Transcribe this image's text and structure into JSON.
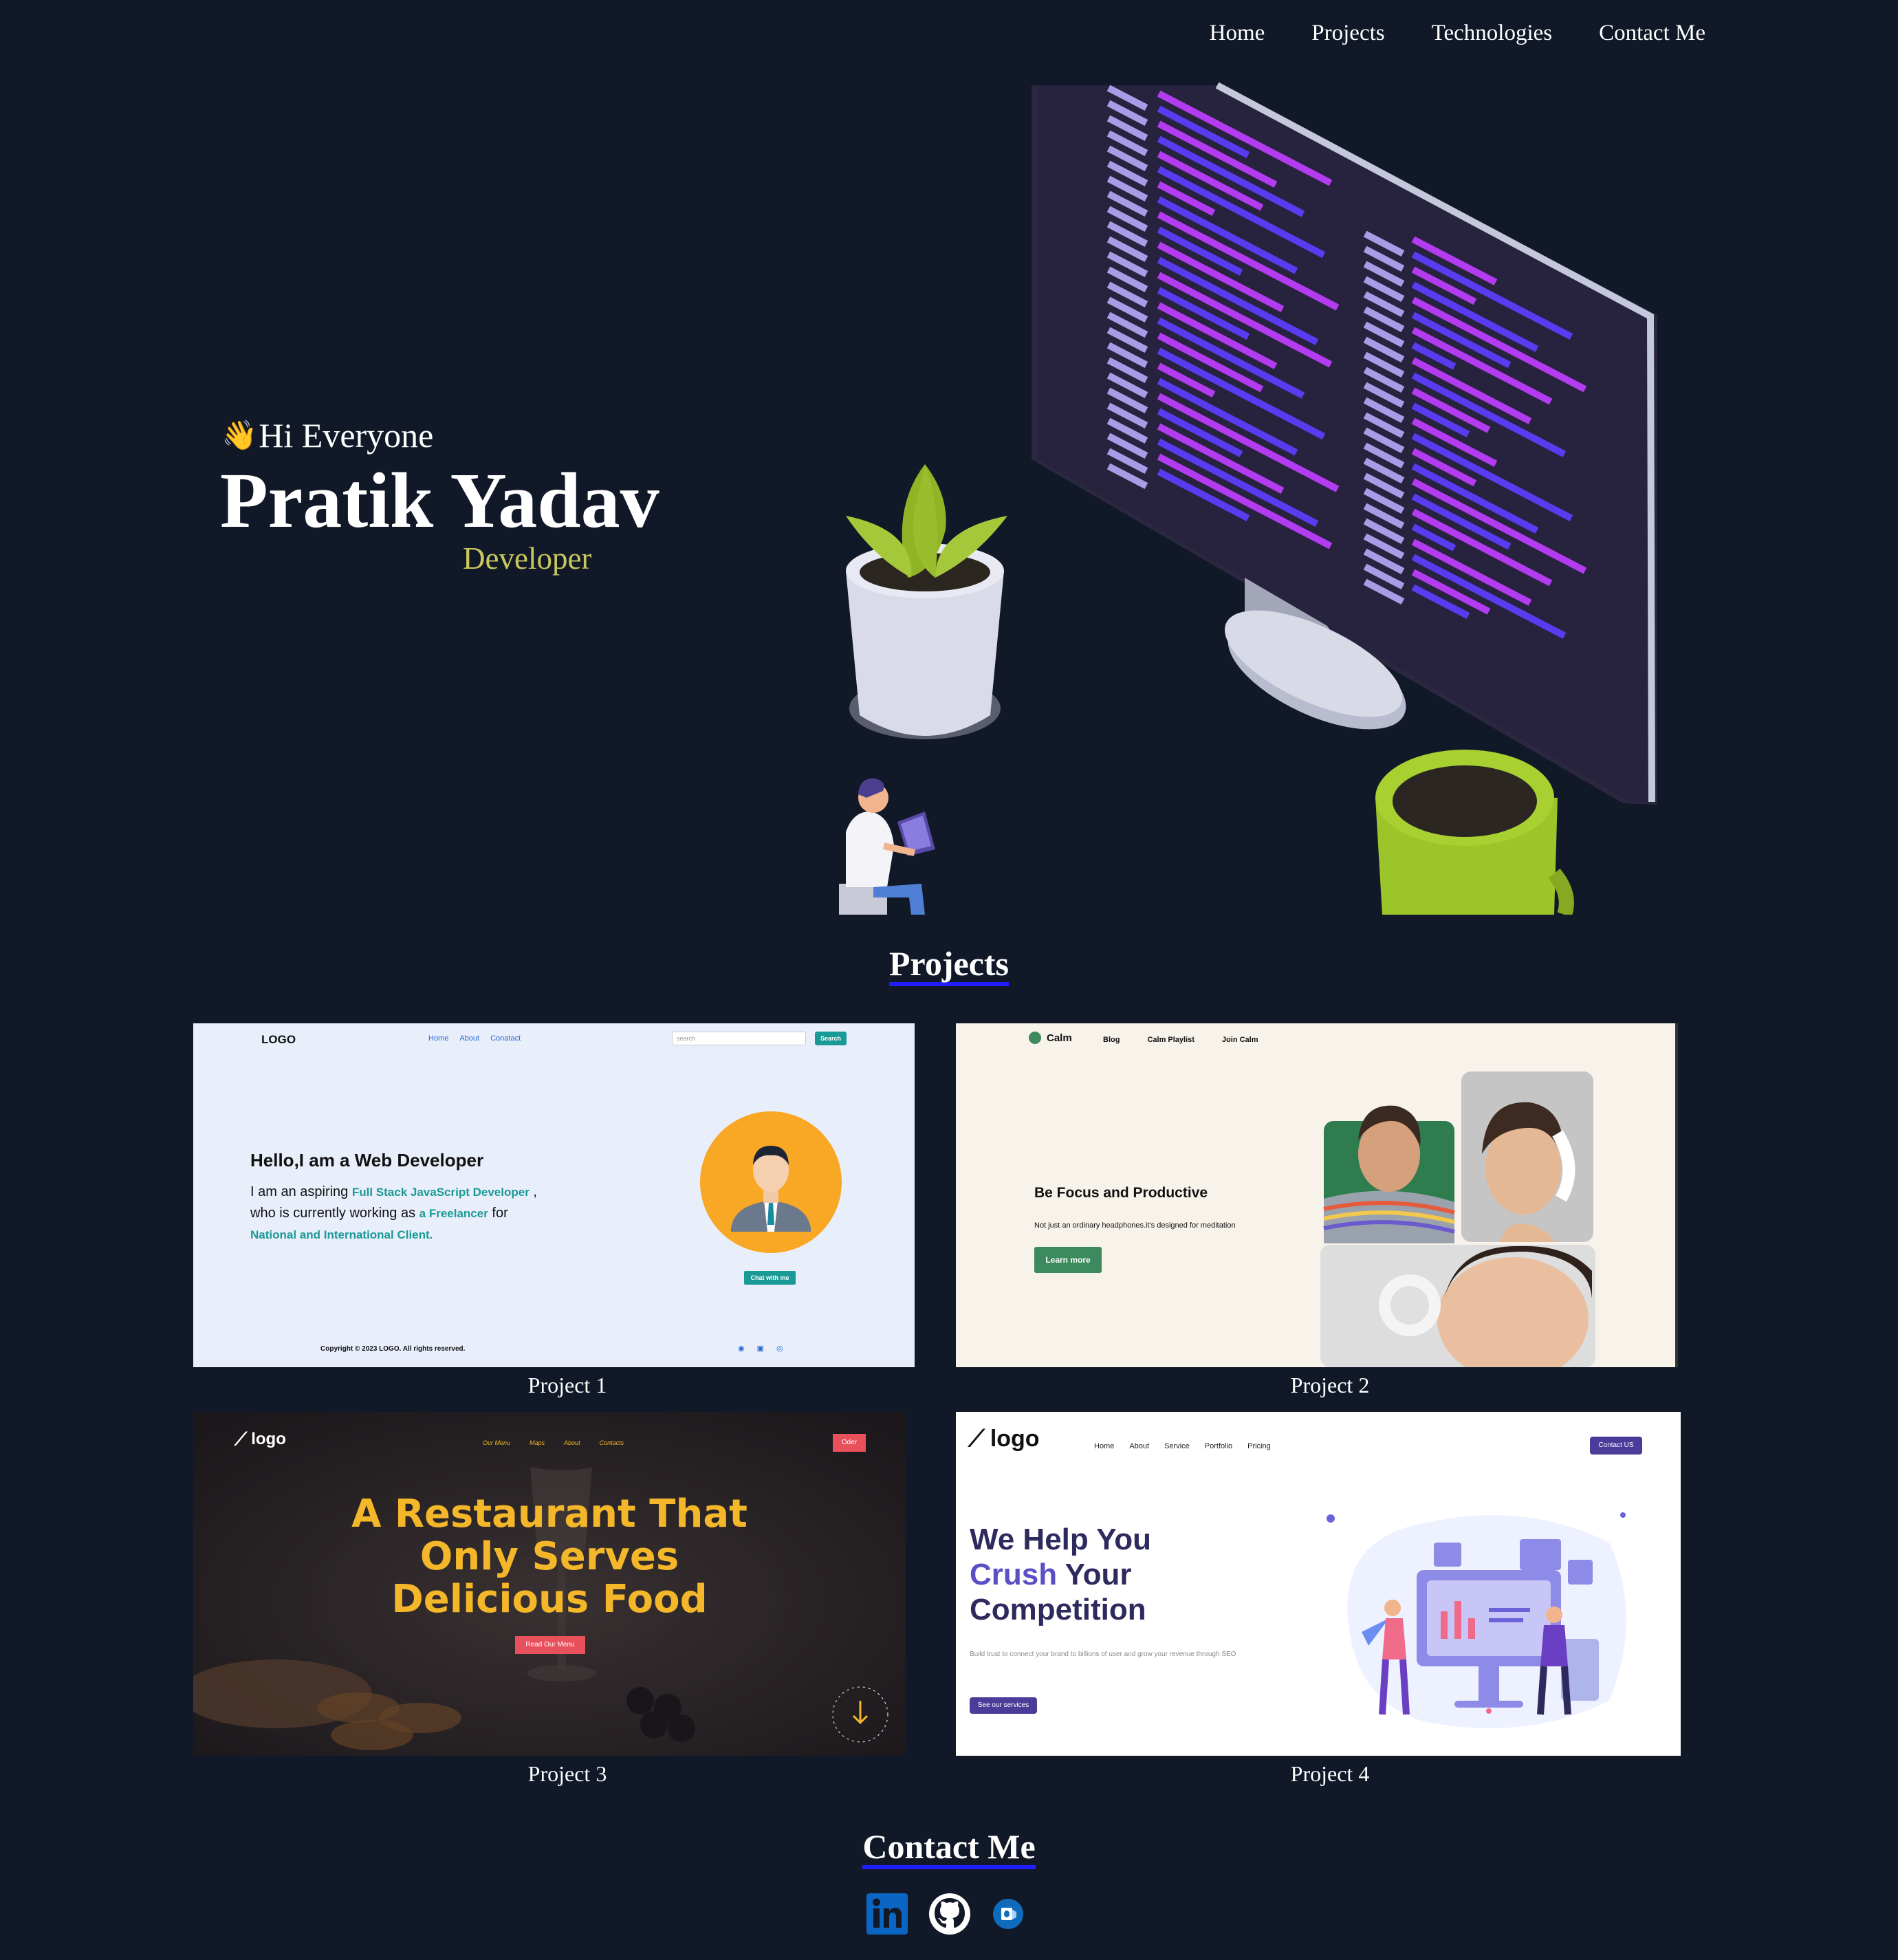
{
  "nav": {
    "items": [
      "Home",
      "Projects",
      "Technologies",
      "Contact Me"
    ]
  },
  "hero": {
    "greeting_emoji": "👋",
    "greeting": "Hi Everyone",
    "name": "Pratik Yadav",
    "role": "Developer"
  },
  "projects": {
    "title": "Projects",
    "items": [
      {
        "caption": "Project 1",
        "logo": "LOGO",
        "nav": [
          "Home",
          "About",
          "Conatact"
        ],
        "search_placeholder": "search",
        "search_button": "Search",
        "heading": "Hello,I am a Web Developer",
        "body_1": "I am an aspiring",
        "body_hl_1": "Full Stack JavaScript Developer",
        "body_2": ",",
        "body_3": "who is currently working as",
        "body_hl_2": "a Freelancer",
        "body_4": "for",
        "body_hl_3": "National and International Client.",
        "cta": "Chat with me",
        "footer": "Copyright © 2023 LOGO. All rights reserved."
      },
      {
        "caption": "Project 2",
        "logo": "Calm",
        "nav": [
          "Blog",
          "Calm Playlist",
          "Join Calm"
        ],
        "heading": "Be Focus and Productive",
        "sub": "Not just an ordinary headphones.it's designed for meditation",
        "cta": "Learn more"
      },
      {
        "caption": "Project 3",
        "logo": "logo",
        "nav": [
          "Our Menu",
          "Maps",
          "About",
          "Contacts"
        ],
        "order": "Oder",
        "headline_1": "A Restaurant That",
        "headline_2": "Only Serves",
        "headline_3": "Delicious Food",
        "cta": "Read Our Menu",
        "scroll_text": "scroll • scroll •"
      },
      {
        "caption": "Project 4",
        "logo": "logo",
        "nav": [
          "Home",
          "About",
          "Service",
          "Portfolio",
          "Pricing"
        ],
        "contact_btn": "Contact US",
        "headline_1": "We Help You",
        "headline_2a": "Crush",
        "headline_2b": "Your",
        "headline_3": "Competition",
        "sub": "Build trust to connect your brand to billions of user and grow your revenue through SEO",
        "cta": "See our services"
      }
    ]
  },
  "contact": {
    "title": "Contact Me",
    "icons": [
      "linkedin-icon",
      "github-icon",
      "outlook-icon"
    ]
  },
  "colors": {
    "background": "#111827",
    "accent_underline": "#1f1fff",
    "role_color": "#c9c85f",
    "p1_teal": "#1a9a96",
    "p2_green": "#3d8a5e",
    "p3_yellow": "#f5b72a",
    "p3_red": "#e8505b",
    "p4_purple": "#4a3d99"
  }
}
